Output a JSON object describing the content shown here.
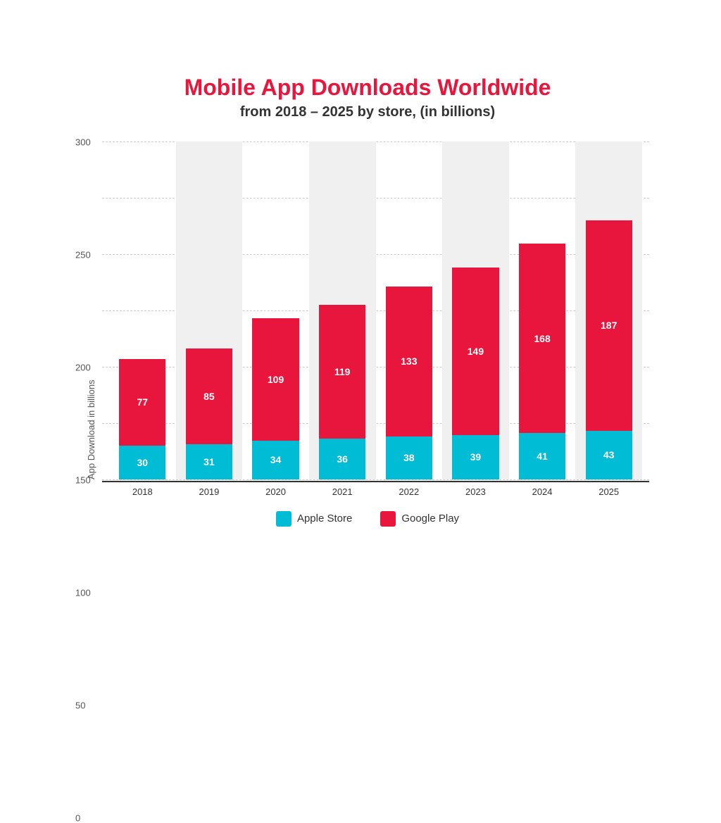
{
  "title": "Mobile App Downloads Worldwide",
  "subtitle": "from 2018 – 2025 by store, (in billions)",
  "y_axis_label": "App Download in billions",
  "y_axis": {
    "min": 0,
    "max": 300,
    "ticks": [
      0,
      50,
      100,
      150,
      200,
      250,
      300
    ]
  },
  "bars": [
    {
      "year": "2018",
      "apple": 30,
      "google": 77,
      "shaded": false
    },
    {
      "year": "2019",
      "apple": 31,
      "google": 85,
      "shaded": true
    },
    {
      "year": "2020",
      "apple": 34,
      "google": 109,
      "shaded": false
    },
    {
      "year": "2021",
      "apple": 36,
      "google": 119,
      "shaded": true
    },
    {
      "year": "2022",
      "apple": 38,
      "google": 133,
      "shaded": false
    },
    {
      "year": "2023",
      "apple": 39,
      "google": 149,
      "shaded": true
    },
    {
      "year": "2024",
      "apple": 41,
      "google": 168,
      "shaded": false
    },
    {
      "year": "2025",
      "apple": 43,
      "google": 187,
      "shaded": true
    }
  ],
  "legend": {
    "apple_label": "Apple Store",
    "google_label": "Google Play",
    "apple_color": "#00bcd4",
    "google_color": "#e8163d"
  },
  "colors": {
    "title": "#e8163d",
    "subtitle": "#333333"
  }
}
